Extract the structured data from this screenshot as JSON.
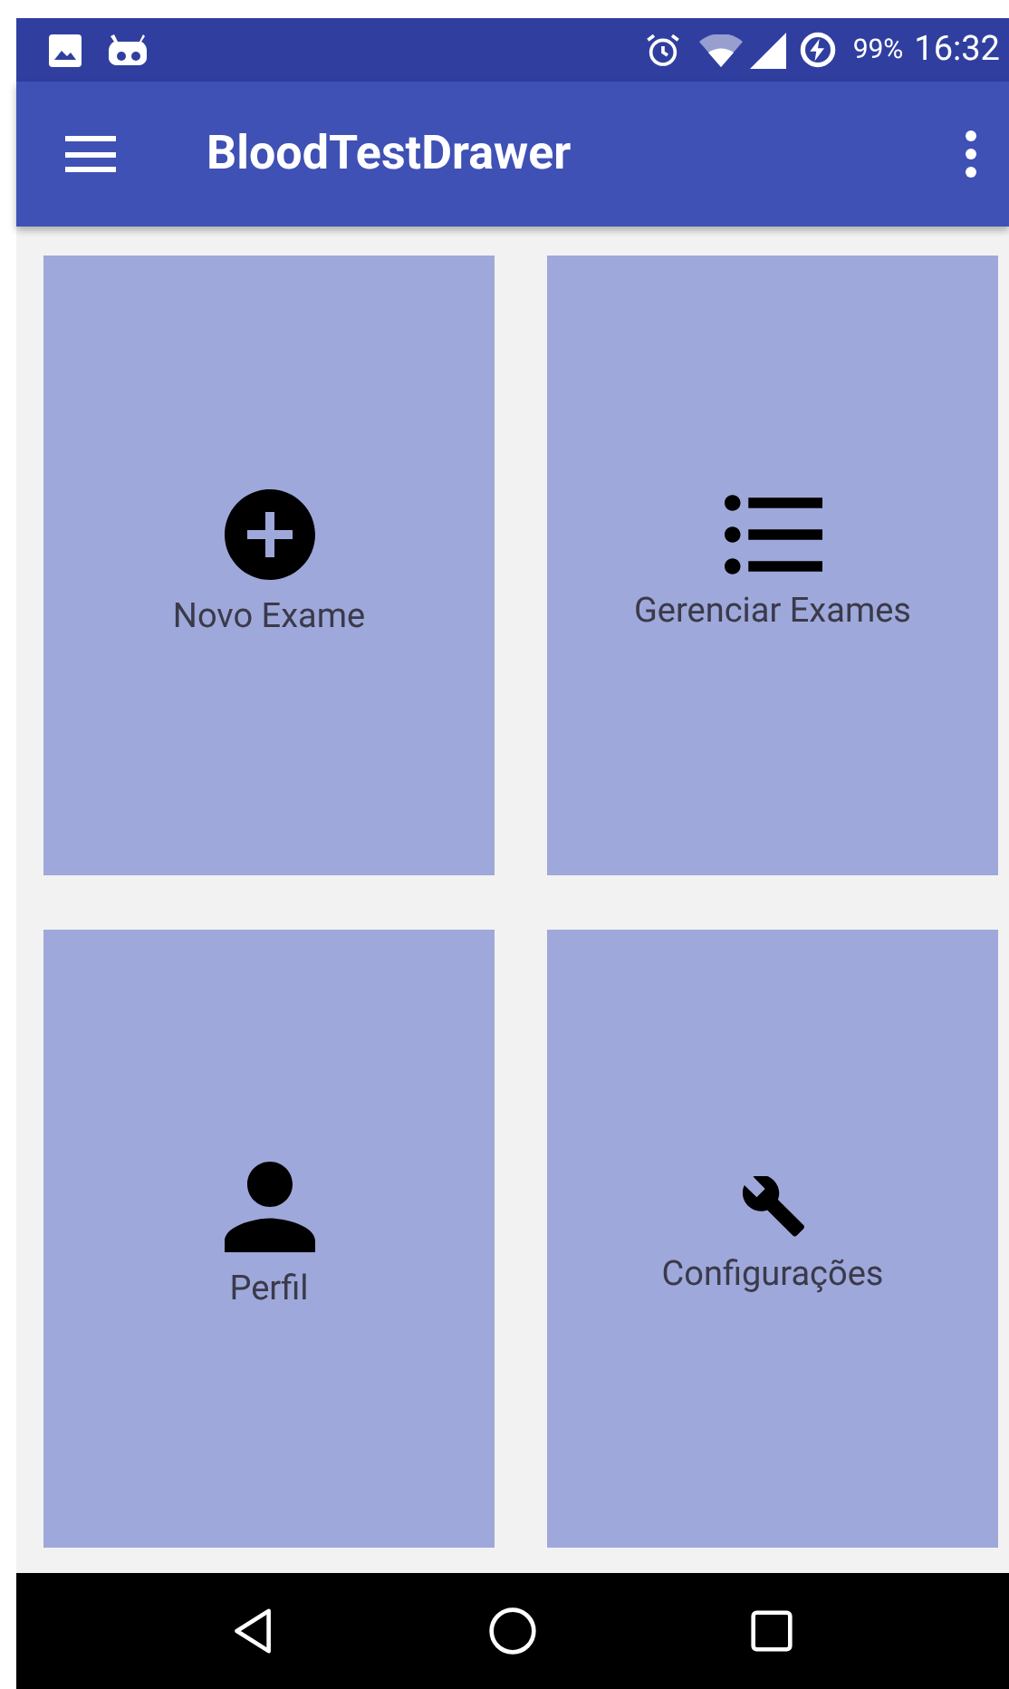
{
  "status_bar": {
    "battery": "99%",
    "time": "16:32"
  },
  "app_bar": {
    "title": "BloodTestDrawer"
  },
  "tiles": [
    {
      "kind": "add",
      "label": "Novo Exame"
    },
    {
      "kind": "list",
      "label": "Gerenciar Exames"
    },
    {
      "kind": "person",
      "label": "Perfil"
    },
    {
      "kind": "wrench",
      "label": "Configurações"
    }
  ]
}
